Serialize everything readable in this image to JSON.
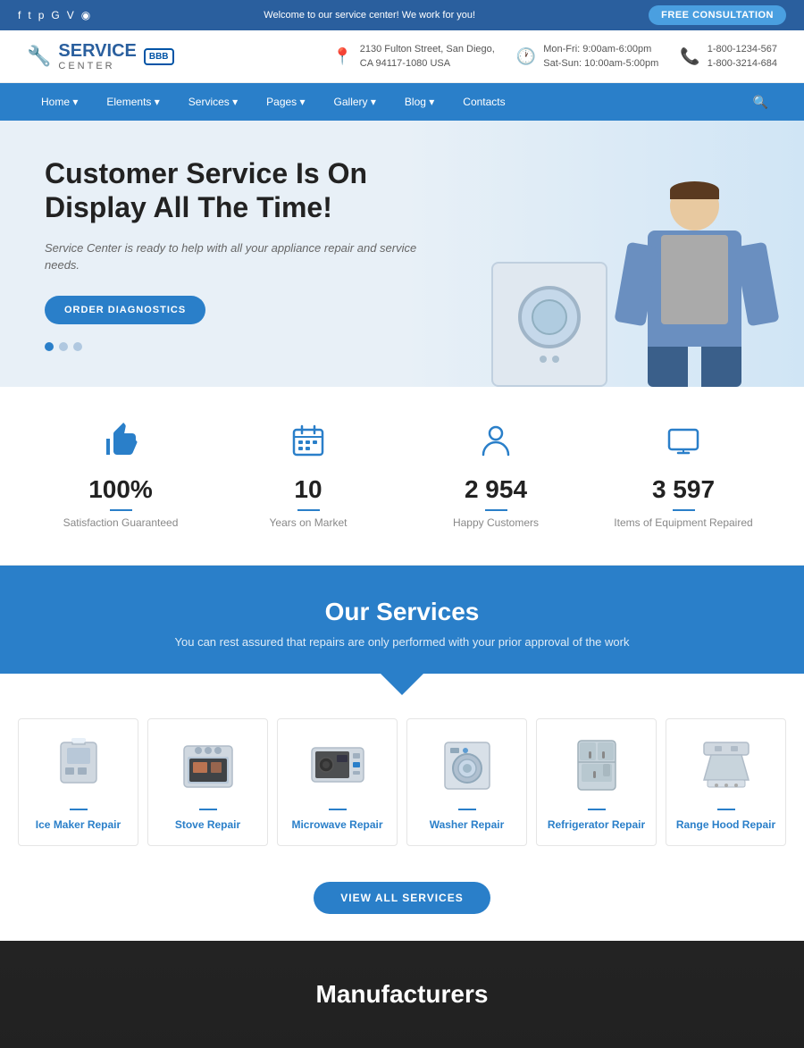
{
  "topbar": {
    "social_icons": [
      "f",
      "t",
      "p",
      "g+",
      "v",
      "rss"
    ],
    "welcome_text": "Welcome to our service center! We work for you!",
    "consultation_btn": "FREE CONSULTATION"
  },
  "header": {
    "logo_service": "SERVICE",
    "logo_center": "CENTER",
    "bbb": "BBB",
    "address_icon": "📍",
    "address_line1": "2130 Fulton Street, San Diego,",
    "address_line2": "CA 94117-1080 USA",
    "clock_icon": "🕐",
    "hours_line1": "Mon-Fri: 9:00am-6:00pm",
    "hours_line2": "Sat-Sun: 10:00am-5:00pm",
    "phone_icon": "📞",
    "phone1": "1-800-1234-567",
    "phone2": "1-800-3214-684"
  },
  "navbar": {
    "links": [
      "Home",
      "Elements",
      "Services",
      "Pages",
      "Gallery",
      "Blog",
      "Contacts"
    ],
    "search_icon": "🔍"
  },
  "hero": {
    "headline": "Customer Service Is On Display All The Time!",
    "subtext": "Service Center is ready to help with all your appliance repair and service needs.",
    "btn_label": "ORDER DIAGNOSTICS",
    "dots": [
      "active",
      "inactive",
      "inactive"
    ]
  },
  "stats": [
    {
      "icon": "👍",
      "number": "100%",
      "label": "Satisfaction Guaranteed"
    },
    {
      "icon": "📅",
      "number": "10",
      "label": "Years on Market"
    },
    {
      "icon": "👤",
      "number": "2 954",
      "label": "Happy Customers"
    },
    {
      "icon": "📺",
      "number": "3 597",
      "label": "Items of Equipment Repaired"
    }
  ],
  "services_section": {
    "heading": "Our Services",
    "subtext": "You can rest assured that repairs are only performed with your prior approval of the work",
    "cards": [
      {
        "label": "Ice Maker Repair",
        "icon": "ice_maker"
      },
      {
        "label": "Stove Repair",
        "icon": "stove"
      },
      {
        "label": "Microwave Repair",
        "icon": "microwave"
      },
      {
        "label": "Washer Repair",
        "icon": "washer"
      },
      {
        "label": "Refrigerator Repair",
        "icon": "fridge"
      },
      {
        "label": "Range Hood Repair",
        "icon": "rangehood"
      }
    ],
    "view_all_btn": "VIEW ALL SERVICES"
  },
  "manufacturers": {
    "heading": "Manufacturers"
  },
  "colors": {
    "primary_blue": "#2a7fc9",
    "dark_blue": "#2a5f9e",
    "light_bg": "#e8f0f7"
  }
}
